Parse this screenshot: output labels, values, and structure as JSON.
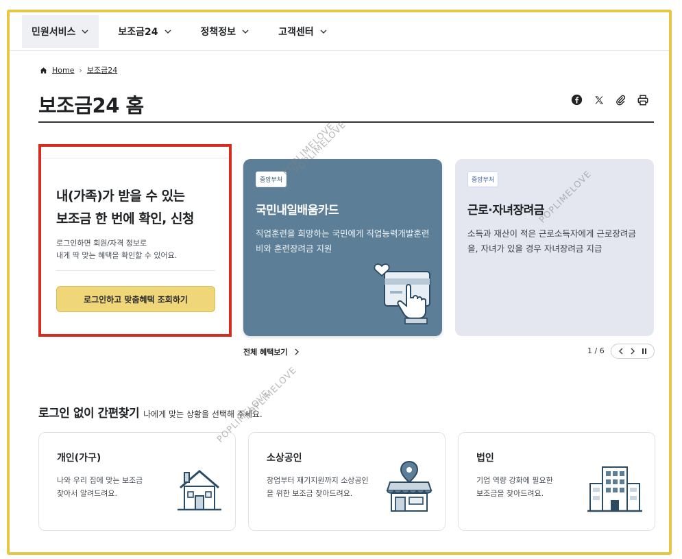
{
  "nav": {
    "items": [
      {
        "label": "민원서비스"
      },
      {
        "label": "보조금24"
      },
      {
        "label": "정책정보"
      },
      {
        "label": "고객센터"
      }
    ]
  },
  "breadcrumb": {
    "home": "Home",
    "current": "보조금24"
  },
  "page": {
    "title": "보조금24 홈"
  },
  "share_icons": [
    "facebook-icon",
    "x-icon",
    "clip-icon",
    "print-icon"
  ],
  "login_box": {
    "heading_line1": "내(가족)가 받을 수 있는",
    "heading_line2": "보조금 한 번에 확인, 신청",
    "desc_line1": "로그인하면 회원/자격 정보로",
    "desc_line2": "내게 딱 맞는 혜택을 확인할 수 있어요.",
    "button": "로그인하고 맞춤혜택 조회하기"
  },
  "cards": [
    {
      "badge": "중앙부처",
      "title": "국민내일배움카드",
      "desc": "직업훈련을 희망하는 국민에게 직업능력개발훈련비와 훈련장려금 지원"
    },
    {
      "badge": "중앙부처",
      "title": "근로·자녀장려금",
      "desc": "소득과 재산이 적은 근로소득자에게 근로장려금을, 자녀가 있을 경우 자녀장려금 지급"
    }
  ],
  "carousel": {
    "view_all": "전체 혜택보기",
    "page_current": "1",
    "page_total": "6"
  },
  "quick_find": {
    "title": "로그인 없이 간편찾기",
    "subtitle": "나에게 맞는 상황을 선택해 주세요.",
    "tiles": [
      {
        "title": "개인(가구)",
        "desc_line1": "나와 우리 집에 맞는 보조금",
        "desc_line2": "찾아서 알려드려요."
      },
      {
        "title": "소상공인",
        "desc_line1": "창업부터 재기지원까지 소상공인",
        "desc_line2": "을 위한 보조금 찾아드려요."
      },
      {
        "title": "법인",
        "desc_line1": "기업 역량 강화에 필요한",
        "desc_line2": "보조금을 찾아드려요."
      }
    ]
  },
  "watermark": "POPLIMELOVE",
  "colors": {
    "frame": "#e6c547",
    "highlight": "#d62b20",
    "login_button": "#eed679",
    "card1": "#5c7f97",
    "card2": "#e4e7f0"
  }
}
